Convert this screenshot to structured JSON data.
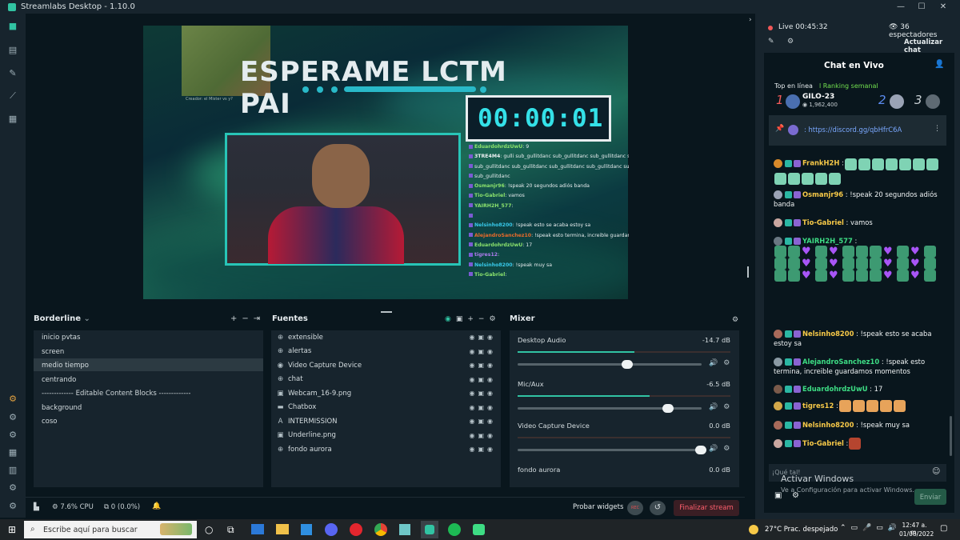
{
  "window": {
    "title": "Streamlabs Desktop - 1.10.0",
    "controls": [
      "—",
      "☐",
      "✕"
    ]
  },
  "preview": {
    "game_caption": "Creador: el Mister vs y?",
    "title": "ESPERAME LCTM PAI",
    "timer": "00:00:01",
    "overlay_chat": [
      {
        "user": "EduardohrdzUwU",
        "text": ": 9",
        "color": "#8be36d"
      },
      {
        "user": "3TRE4M4",
        "text": ": gulli sub_gullitdanc sub_gullitdanc sub_gullitdanc sub",
        "color": "#e9eef0"
      },
      {
        "user": "",
        "text": "sub_gullitdanc sub_gullitdanc sub_gullitdanc sub_gullitdanc su",
        "color": "#e9eef0"
      },
      {
        "user": "",
        "text": "sub_gullitdanc",
        "color": "#e9eef0"
      },
      {
        "user": "Osmanjr96",
        "text": ": !speak 20 segundos adiós banda",
        "color": "#8be36d"
      },
      {
        "user": "Tio-Gabriel",
        "text": ": vamos",
        "color": "#8be36d"
      },
      {
        "user": "YAIRH2H_577",
        "text": ":",
        "color": "#8be36d"
      },
      {
        "user": "",
        "text": "",
        "color": "#e9eef0"
      },
      {
        "user": "Nelsinho8200",
        "text": ": !speak esto se acaba estoy sa",
        "color": "#38c9ea"
      },
      {
        "user": "AlejandroSanchez10",
        "text": ": !speak esto termina, increible guardam",
        "color": "#e86a2a"
      },
      {
        "user": "EduardohrdzUwU",
        "text": ": 17",
        "color": "#8be36d"
      },
      {
        "user": "tigres12",
        "text": ":",
        "color": "#b07cf0"
      },
      {
        "user": "Nelsinho8200",
        "text": ": !speak muy sa",
        "color": "#38c9ea"
      },
      {
        "user": "Tio-Gabriel",
        "text": ":",
        "color": "#8be36d"
      }
    ]
  },
  "scenes": {
    "title": "Borderline",
    "items": [
      "inicio pvtas",
      "screen",
      "medio tiempo",
      "centrando",
      "------------- Editable Content Blocks -------------",
      "background",
      "coso"
    ],
    "selected": 2
  },
  "sources": {
    "title": "Fuentes",
    "items": [
      {
        "icon": "globe-icon",
        "label": "extensible"
      },
      {
        "icon": "globe-icon",
        "label": "alertas"
      },
      {
        "icon": "camera-icon",
        "label": "Video Capture Device"
      },
      {
        "icon": "globe-icon",
        "label": "chat"
      },
      {
        "icon": "image-icon",
        "label": "Webcam_16-9.png"
      },
      {
        "icon": "folder-icon",
        "label": "Chatbox"
      },
      {
        "icon": "text-icon",
        "label": "INTERMISSION"
      },
      {
        "icon": "image-icon",
        "label": "Underline.png"
      },
      {
        "icon": "globe-icon",
        "label": "fondo aurora"
      }
    ]
  },
  "mixer": {
    "title": "Mixer",
    "items": [
      {
        "name": "Desktop Audio",
        "value": "-14.7 dB",
        "level": 0.6
      },
      {
        "name": "Mic/Aux",
        "value": "-6.5 dB",
        "level": 0.82
      },
      {
        "name": "Video Capture Device",
        "value": "0.0 dB",
        "level": 1.0
      },
      {
        "name": "fondo aurora",
        "value": "0.0 dB",
        "level": 1.0
      }
    ]
  },
  "status": {
    "cpu": "7.6% CPU",
    "dropped": "0 (0.0%)",
    "test_widgets": "Probar widgets",
    "rec": "REC",
    "end_stream": "Finalizar stream"
  },
  "right": {
    "live": "Live 00:45:32",
    "viewers": "36 espectadores",
    "refresh": "Actualizar chat",
    "chat_title": "Chat en Vivo",
    "top_label": "Top en línea",
    "ranking_label": "l Ranking semanal",
    "rank1": {
      "pos": "1",
      "name": "GILO-23",
      "points": "1,962,400"
    },
    "rank2": "2",
    "rank3": "3",
    "pinned": ": https://discord.gg/qbHfrC6A",
    "input_placeholder": "¡Qué tal!",
    "send": "Enviar"
  },
  "activate": {
    "title": "Activar Windows",
    "subtitle": "Ve a Configuración para activar Windows."
  },
  "taskbar": {
    "search": "Escribe aquí para buscar",
    "weather": "27°C  Prac. despejado",
    "time": "12:47 a. m.",
    "date": "01/08/2022"
  }
}
